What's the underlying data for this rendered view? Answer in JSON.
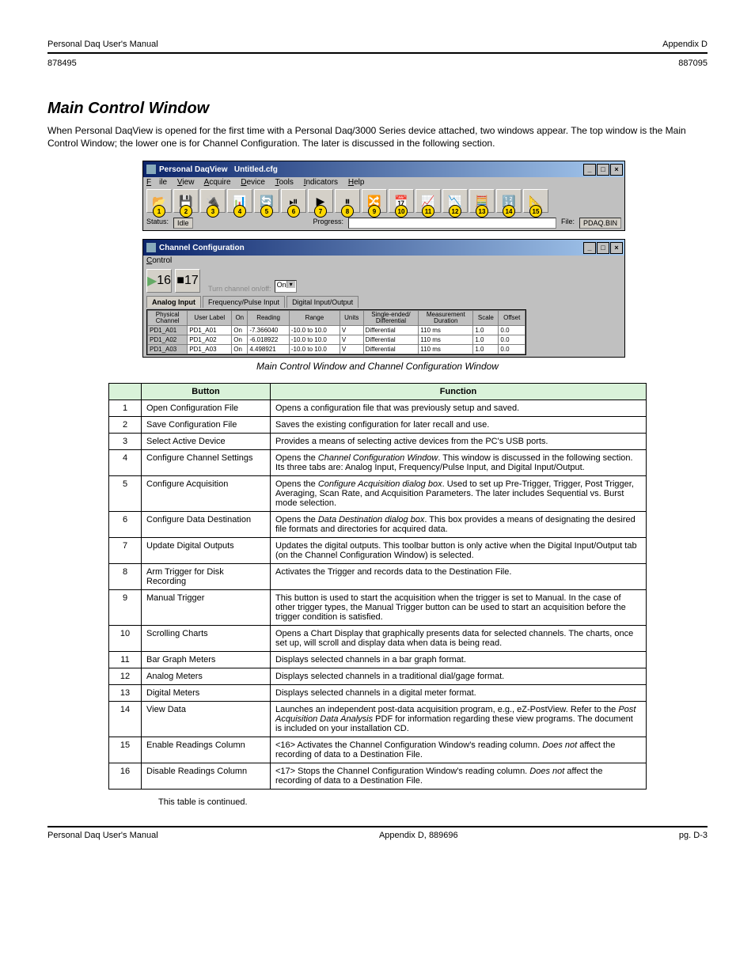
{
  "header": {
    "left": "Personal Daq User's Manual",
    "right": "Appendix D"
  },
  "subheader": {
    "left": "878495",
    "right": "887095"
  },
  "footer": {
    "left": "Personal Daq User's Manual",
    "center": "Appendix D,",
    "center2": "889696",
    "right": "pg. D-3"
  },
  "section": {
    "heading": "Main Control Window",
    "para": "When Personal DaqView is opened for the first time with a Personal Daq/3000 Series device attached, two windows appear. The top window is the Main Control Window; the lower one is for Channel Configuration. The later is discussed in the following section.",
    "caption": "Main Control Window and Channel Configuration Window",
    "endnote": "This table is continued."
  },
  "win1": {
    "title_app": "Personal DaqView",
    "title_file": "Untitled.cfg",
    "menus": [
      "File",
      "View",
      "Acquire",
      "Device",
      "Tools",
      "Indicators",
      "Help"
    ],
    "status_label": "Status:",
    "status_value": "Idle",
    "progress_label": "Progress:",
    "file_label": "File:",
    "file_value": "PDAQ.BIN",
    "tool_icons": [
      "📂",
      "💾",
      "🔌",
      "📊",
      "🔄",
      "⏯",
      "▶",
      "⏸",
      "🔀",
      "📅",
      "📈",
      "📉",
      "🧮",
      "🔢",
      "📐"
    ]
  },
  "win2": {
    "title": "Channel Configuration",
    "menu": "Control",
    "btn_icons": [
      "▶",
      "■"
    ],
    "turn_label": "Turn channel on/off:",
    "turn_value": "On",
    "tabs": [
      "Analog Input",
      "Frequency/Pulse Input",
      "Digital Input/Output"
    ],
    "cols": [
      "Physical\nChannel",
      "User Label",
      "On",
      "Reading",
      "Range",
      "Units",
      "Single-ended/\nDifferential",
      "Measurement\nDuration",
      "Scale",
      "Offset"
    ],
    "rows": [
      [
        "PD1_A01",
        "PD1_A01",
        "On",
        "-7.366040",
        "-10.0 to 10.0",
        "V",
        "Differential",
        "110 ms",
        "1.0",
        "0.0"
      ],
      [
        "PD1_A02",
        "PD1_A02",
        "On",
        "-6.018922",
        "-10.0 to 10.0",
        "V",
        "Differential",
        "110 ms",
        "1.0",
        "0.0"
      ],
      [
        "PD1_A03",
        "PD1_A03",
        "On",
        "4.498921",
        "-10.0 to 10.0",
        "V",
        "Differential",
        "110 ms",
        "1.0",
        "0.0"
      ]
    ]
  },
  "desc_table": {
    "head": [
      "",
      "Button",
      "Function"
    ],
    "rows": [
      {
        "n": "1",
        "name": "Open Configuration File",
        "func": "Opens a configuration file that was previously setup and saved."
      },
      {
        "n": "2",
        "name": "Save Configuration File",
        "func": "Saves the existing configuration for later recall and use."
      },
      {
        "n": "3",
        "name": "Select Active Device",
        "func": "Provides a means of selecting active devices from the PC's USB ports."
      },
      {
        "n": "4",
        "name": "Configure Channel Settings",
        "func": "Opens the <i>Channel Configuration Window</i>. This window is discussed in the following section. Its three tabs are: Analog Input, Frequency/Pulse Input, and Digital Input/Output."
      },
      {
        "n": "5",
        "name": "Configure Acquisition",
        "func": "Opens the <i>Configure Acquisition dialog box</i>. Used to set up Pre-Trigger, Trigger, Post Trigger, Averaging, Scan Rate, and Acquisition Parameters. The later includes Sequential vs. Burst mode selection."
      },
      {
        "n": "6",
        "name": "Configure Data Destination",
        "func": "Opens the <i>Data Destination dialog box</i>. This box provides a means of designating the desired file formats and directories for acquired data."
      },
      {
        "n": "7",
        "name": "Update Digital Outputs",
        "func": "Updates the digital outputs. This toolbar button is only active when the Digital Input/Output tab (on the Channel Configuration Window) is selected."
      },
      {
        "n": "8",
        "name": "Arm Trigger for Disk Recording",
        "func": "Activates the Trigger and records data to the Destination File."
      },
      {
        "n": "9",
        "name": "Manual Trigger",
        "func": "This button is used to start the acquisition when the trigger is set to Manual. In the case of other trigger types, the Manual Trigger button can be used to start an acquisition before the trigger condition is satisfied."
      },
      {
        "n": "10",
        "name": "Scrolling Charts",
        "func": "Opens a Chart Display that graphically presents data for selected channels. The charts, once set up, will scroll and display data when data is being read."
      },
      {
        "n": "11",
        "name": "Bar Graph Meters",
        "func": "Displays selected channels in a bar graph format."
      },
      {
        "n": "12",
        "name": "Analog Meters",
        "func": "Displays selected channels in a traditional dial/gage format."
      },
      {
        "n": "13",
        "name": "Digital Meters",
        "func": "Displays selected channels in a digital meter format."
      },
      {
        "n": "14",
        "name": "View Data",
        "func": "Launches an independent post-data acquisition program, e.g., eZ-PostView. Refer to the <i>Post Acquisition Data Analysis</i> PDF for information regarding these view programs. The document is included on your installation CD."
      },
      {
        "n": "15",
        "name": "Enable Readings Column",
        "func": "&lt;16&gt; Activates the Channel Configuration Window's reading column. <i>Does not</i> affect the recording of data to a Destination File."
      },
      {
        "n": "16",
        "name": "Disable Readings Column",
        "func": "&lt;17&gt; Stops the Channel Configuration Window's reading column. <i>Does not</i> affect the recording of data to a Destination File."
      }
    ]
  }
}
